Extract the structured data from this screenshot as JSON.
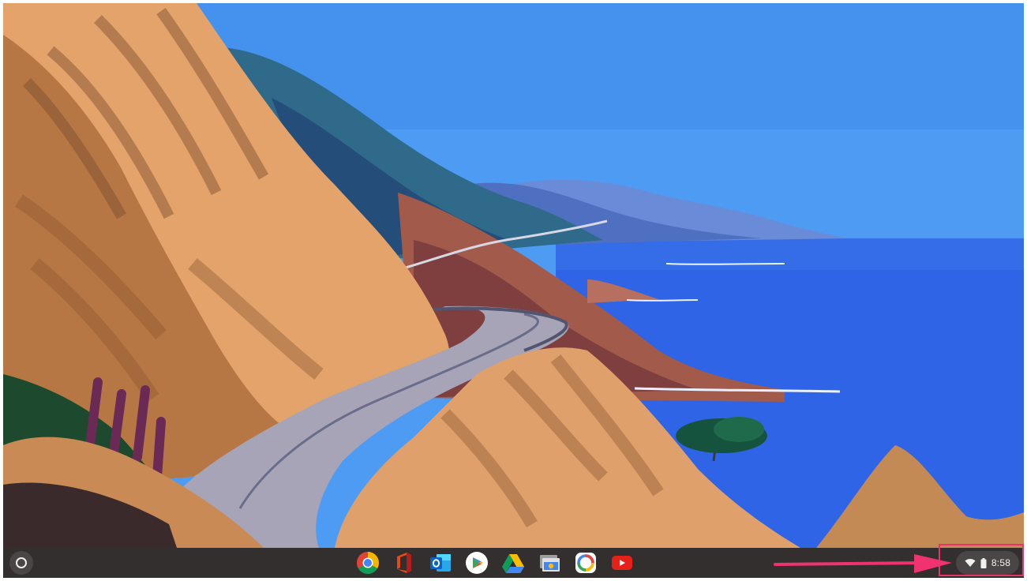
{
  "desktop": {
    "wallpaper": "coastal-road-cliffs-illustration"
  },
  "shelf": {
    "launcher_icon": "launcher-circle-icon",
    "apps": [
      {
        "id": "chrome",
        "icon": "chrome-icon"
      },
      {
        "id": "office",
        "icon": "office-icon"
      },
      {
        "id": "outlook",
        "icon": "outlook-icon"
      },
      {
        "id": "play-store",
        "icon": "play-store-icon"
      },
      {
        "id": "drive",
        "icon": "drive-icon"
      },
      {
        "id": "chrome-remote-desktop",
        "icon": "remote-desktop-icon"
      },
      {
        "id": "photo-app",
        "icon": "photo-app-icon"
      },
      {
        "id": "youtube",
        "icon": "youtube-icon"
      }
    ],
    "status": {
      "wifi_icon": "wifi-icon",
      "battery_icon": "battery-icon",
      "time": "8:58"
    }
  },
  "annotation": {
    "highlight_color": "#e8336b",
    "arrow_color": "#f0336e"
  }
}
